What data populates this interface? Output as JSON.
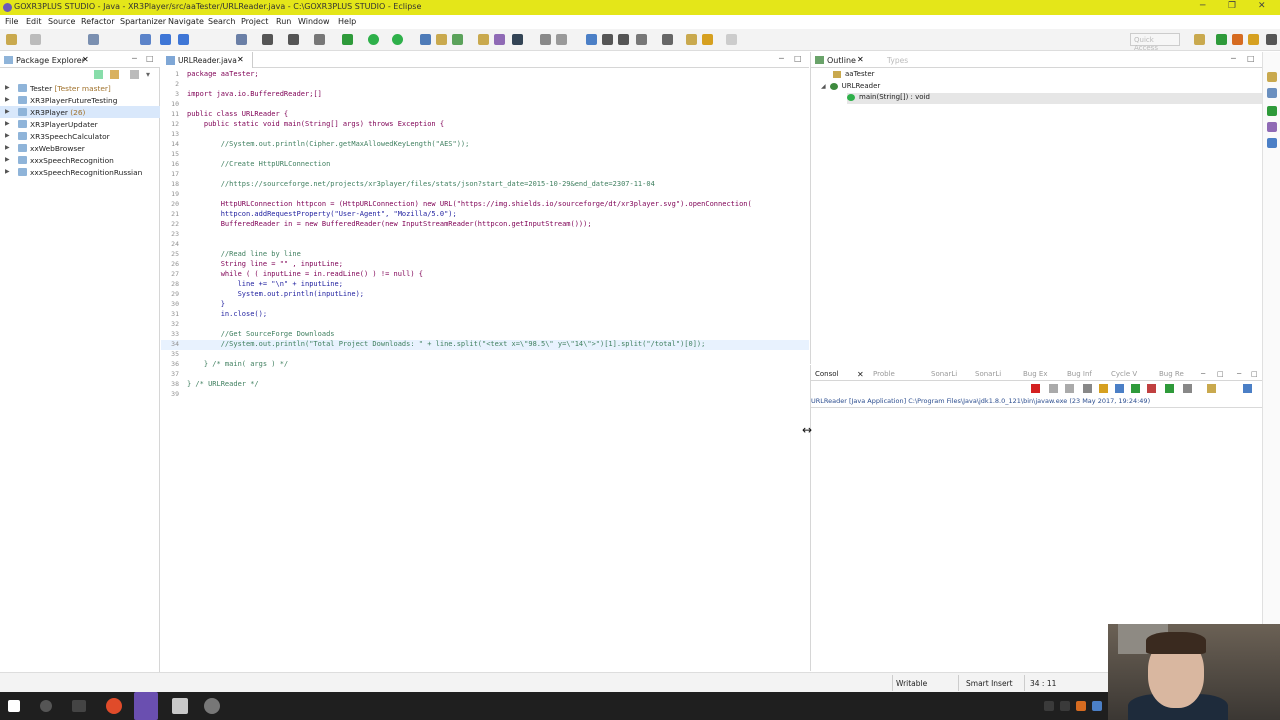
{
  "window": {
    "title": "GOXR3PLUS STUDIO - Java - XR3Player/src/aaTester/URLReader.java - C:\\GOXR3PLUS STUDIO - Eclipse"
  },
  "menu": [
    "File",
    "Edit",
    "Source",
    "Refactor",
    "Spartanizer",
    "Navigate",
    "Search",
    "Project",
    "Run",
    "Window",
    "Help"
  ],
  "toolbar": {
    "quick_access": "Quick Access"
  },
  "package_explorer": {
    "title": "Package Explorer",
    "items": [
      {
        "label": "Tester",
        "deco": "[Tester master]"
      },
      {
        "label": "XR3PlayerFutureTesting",
        "deco": ""
      },
      {
        "label": "XR3Player",
        "deco": "(26)"
      },
      {
        "label": "XR3PlayerUpdater",
        "deco": ""
      },
      {
        "label": "XR3SpeechCalculator",
        "deco": ""
      },
      {
        "label": "xxWebBrowser",
        "deco": ""
      },
      {
        "label": "xxxSpeechRecognition",
        "deco": ""
      },
      {
        "label": "xxxSpeechRecognitionRussian",
        "deco": ""
      }
    ]
  },
  "editor": {
    "tab": "URLReader.java",
    "lines": [
      {
        "n": "1",
        "code": "package aaTester;"
      },
      {
        "n": "2",
        "code": ""
      },
      {
        "n": "3",
        "code": "import java.io.BufferedReader;[]"
      },
      {
        "n": "10",
        "code": ""
      },
      {
        "n": "11",
        "code": "public class URLReader {"
      },
      {
        "n": "12",
        "code": "    public static void main(String[] args) throws Exception {"
      },
      {
        "n": "13",
        "code": ""
      },
      {
        "n": "14",
        "code": "        //System.out.println(Cipher.getMaxAllowedKeyLength(\"AES\"));"
      },
      {
        "n": "15",
        "code": ""
      },
      {
        "n": "16",
        "code": "        //Create HttpURLConnection"
      },
      {
        "n": "17",
        "code": ""
      },
      {
        "n": "18",
        "code": "        //https://sourceforge.net/projects/xr3player/files/stats/json?start_date=2015-10-29&end_date=2307-11-04"
      },
      {
        "n": "19",
        "code": ""
      },
      {
        "n": "20",
        "code": "        HttpURLConnection httpcon = (HttpURLConnection) new URL(\"https://img.shields.io/sourceforge/dt/xr3player.svg\").openConnection("
      },
      {
        "n": "21",
        "code": "        httpcon.addRequestProperty(\"User-Agent\", \"Mozilla/5.0\");"
      },
      {
        "n": "22",
        "code": "        BufferedReader in = new BufferedReader(new InputStreamReader(httpcon.getInputStream()));"
      },
      {
        "n": "23",
        "code": ""
      },
      {
        "n": "24",
        "code": ""
      },
      {
        "n": "25",
        "code": "        //Read line by line"
      },
      {
        "n": "26",
        "code": "        String line = \"\" , inputLine;"
      },
      {
        "n": "27",
        "code": "        while ( ( inputLine = in.readLine() ) != null) {"
      },
      {
        "n": "28",
        "code": "            line += \"\\n\" + inputLine;"
      },
      {
        "n": "29",
        "code": "            System.out.println(inputLine);"
      },
      {
        "n": "30",
        "code": "        }"
      },
      {
        "n": "31",
        "code": "        in.close();"
      },
      {
        "n": "32",
        "code": ""
      },
      {
        "n": "33",
        "code": "        //Get SourceForge Downloads"
      },
      {
        "n": "34",
        "code": "        //System.out.println(\"Total Project Downloads: \" + line.split(\"<text x=\\\"98.5\\\" y=\\\"14\\\">\")[1].split(\"/total\")[0]);"
      },
      {
        "n": "35",
        "code": ""
      },
      {
        "n": "36",
        "code": "    } /* main( args ) */"
      },
      {
        "n": "37",
        "code": ""
      },
      {
        "n": "38",
        "code": "} /* URLReader */"
      },
      {
        "n": "39",
        "code": ""
      }
    ]
  },
  "outline": {
    "title": "Outline",
    "types_label": "Types",
    "items": [
      {
        "label": "aaTester"
      },
      {
        "label": "URLReader"
      },
      {
        "label": "main(String[]) : void"
      }
    ]
  },
  "console": {
    "tabs": [
      "Consol",
      "Proble",
      "SonarLi",
      "SonarLi",
      "Bug Ex",
      "Bug Inf",
      "Cycle V",
      "Bug Re"
    ],
    "info": "URLReader [Java Application] C:\\Program Files\\Java\\jdk1.8.0_121\\bin\\javaw.exe (23 May 2017, 19:24:49)"
  },
  "status": {
    "writable": "Writable",
    "insert": "Smart Insert",
    "position": "34 : 11"
  },
  "colors": {
    "titlebar": "#e4e619",
    "keyword": "#7f0055",
    "comment": "#3f7f5f",
    "string": "#2a00ff"
  }
}
